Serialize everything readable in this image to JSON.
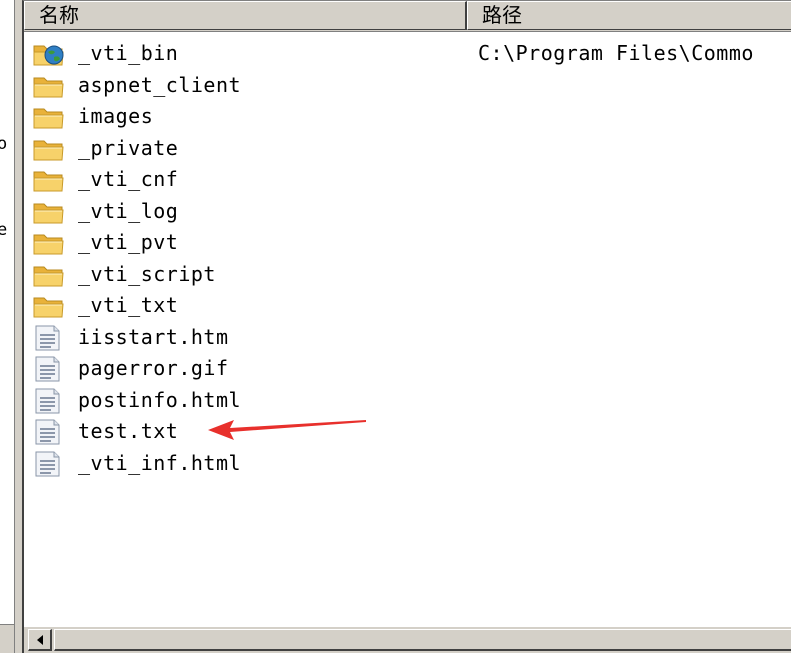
{
  "left_pane": {
    "chars": [
      "o",
      "e"
    ]
  },
  "list": {
    "columns": [
      "名称",
      "路径"
    ],
    "rows": [
      {
        "name": "_vti_bin",
        "path": "C:\\Program Files\\Commo",
        "icon": "globe-folder-icon"
      },
      {
        "name": "aspnet_client",
        "path": "",
        "icon": "folder-icon"
      },
      {
        "name": "images",
        "path": "",
        "icon": "folder-icon"
      },
      {
        "name": "_private",
        "path": "",
        "icon": "folder-icon"
      },
      {
        "name": "_vti_cnf",
        "path": "",
        "icon": "folder-icon"
      },
      {
        "name": "_vti_log",
        "path": "",
        "icon": "folder-icon"
      },
      {
        "name": "_vti_pvt",
        "path": "",
        "icon": "folder-icon"
      },
      {
        "name": "_vti_script",
        "path": "",
        "icon": "folder-icon"
      },
      {
        "name": "_vti_txt",
        "path": "",
        "icon": "folder-icon"
      },
      {
        "name": "iisstart.htm",
        "path": "",
        "icon": "document-icon"
      },
      {
        "name": "pagerror.gif",
        "path": "",
        "icon": "document-icon"
      },
      {
        "name": "postinfo.html",
        "path": "",
        "icon": "document-icon"
      },
      {
        "name": "test.txt",
        "path": "",
        "icon": "document-icon"
      },
      {
        "name": "_vti_inf.html",
        "path": "",
        "icon": "document-icon"
      }
    ]
  },
  "annotation": {
    "arrow_color": "#e8302c",
    "points_to": "test.txt"
  },
  "colors": {
    "folder": "#f5c542",
    "chrome": "#d4d0c8"
  }
}
